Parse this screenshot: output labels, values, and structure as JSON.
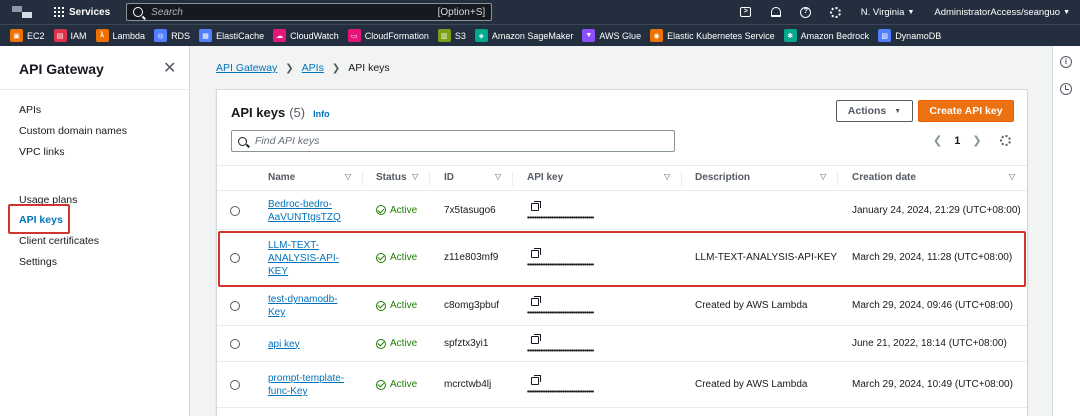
{
  "topnav": {
    "services_label": "Services",
    "search_placeholder": "Search",
    "search_shortcut": "[Option+S]",
    "cloudshell_glyph": ">",
    "help_glyph": "?",
    "region": "N. Virginia",
    "account": "AdministratorAccess/seanguo"
  },
  "favorites": [
    {
      "label": "EC2",
      "color": "#ed7100",
      "glyph": "▣"
    },
    {
      "label": "IAM",
      "color": "#dd344c",
      "glyph": "▤"
    },
    {
      "label": "Lambda",
      "color": "#ed7100",
      "glyph": "λ"
    },
    {
      "label": "RDS",
      "color": "#527fff",
      "glyph": "◎"
    },
    {
      "label": "ElastiCache",
      "color": "#527fff",
      "glyph": "▦"
    },
    {
      "label": "CloudWatch",
      "color": "#e7157b",
      "glyph": "☁"
    },
    {
      "label": "CloudFormation",
      "color": "#e7157b",
      "glyph": "▭"
    },
    {
      "label": "S3",
      "color": "#7aa116",
      "glyph": "▥"
    },
    {
      "label": "Amazon SageMaker",
      "color": "#01a88d",
      "glyph": "◈"
    },
    {
      "label": "AWS Glue",
      "color": "#8c4fff",
      "glyph": "▼"
    },
    {
      "label": "Elastic Kubernetes Service",
      "color": "#ed7100",
      "glyph": "◉"
    },
    {
      "label": "Amazon Bedrock",
      "color": "#01a88d",
      "glyph": "✱"
    },
    {
      "label": "DynamoDB",
      "color": "#527fff",
      "glyph": "▧"
    }
  ],
  "sidebar": {
    "title": "API Gateway",
    "close_glyph": "✕",
    "items": [
      {
        "label": "APIs"
      },
      {
        "label": "Custom domain names"
      },
      {
        "label": "VPC links"
      },
      {
        "label": "Usage plans"
      },
      {
        "label": "API keys"
      },
      {
        "label": "Client certificates"
      },
      {
        "label": "Settings"
      }
    ]
  },
  "breadcrumb": {
    "items": [
      "API Gateway",
      "APIs",
      "API keys"
    ],
    "separator": "❯"
  },
  "panel": {
    "title": "API keys",
    "count": "(5)",
    "info": "Info",
    "actions_label": "Actions",
    "actions_caret": "▼",
    "create_label": "Create API key",
    "find_placeholder": "Find API keys",
    "pager": {
      "prev": "❮",
      "page": "1",
      "next": "❯"
    }
  },
  "table": {
    "columns": [
      "Name",
      "Status",
      "ID",
      "API key",
      "Description",
      "Creation date"
    ],
    "sort_glyph": "▽",
    "masked_key": "••••••••••••••••••••••••••••••••••••",
    "rows": [
      {
        "name_lines": [
          "Bedroc-bedro-",
          "AaVUNTtgsTZQ"
        ],
        "status": "Active",
        "id": "7x5tasugo6",
        "description": "",
        "created": "January 24, 2024, 21:29 (UTC+08:00)"
      },
      {
        "name_lines": [
          "LLM-TEXT-",
          "ANALYSIS-API-",
          "KEY"
        ],
        "status": "Active",
        "id": "z11e803mf9",
        "description": "LLM-TEXT-ANALYSIS-API-KEY",
        "created": "March 29, 2024, 11:28 (UTC+08:00)"
      },
      {
        "name_lines": [
          "test-dynamodb-",
          "Key"
        ],
        "status": "Active",
        "id": "c8omg3pbuf",
        "description": "Created by AWS Lambda",
        "created": "March 29, 2024, 09:46 (UTC+08:00)"
      },
      {
        "name_lines": [
          "api key"
        ],
        "status": "Active",
        "id": "spfztx3yi1",
        "description": "",
        "created": "June 21, 2022, 18:14 (UTC+08:00)"
      },
      {
        "name_lines": [
          "prompt-template-",
          "func-Key"
        ],
        "status": "Active",
        "id": "mcrctwb4lj",
        "description": "Created by AWS Lambda",
        "created": "March 29, 2024, 10:49 (UTC+08:00)"
      }
    ]
  },
  "rail": {
    "info_glyph": "i"
  },
  "colors": {
    "nav_bg": "#232f3e",
    "link": "#0073bb",
    "primary": "#ec7211",
    "success": "#1d8102",
    "highlight": "#d0352d"
  }
}
